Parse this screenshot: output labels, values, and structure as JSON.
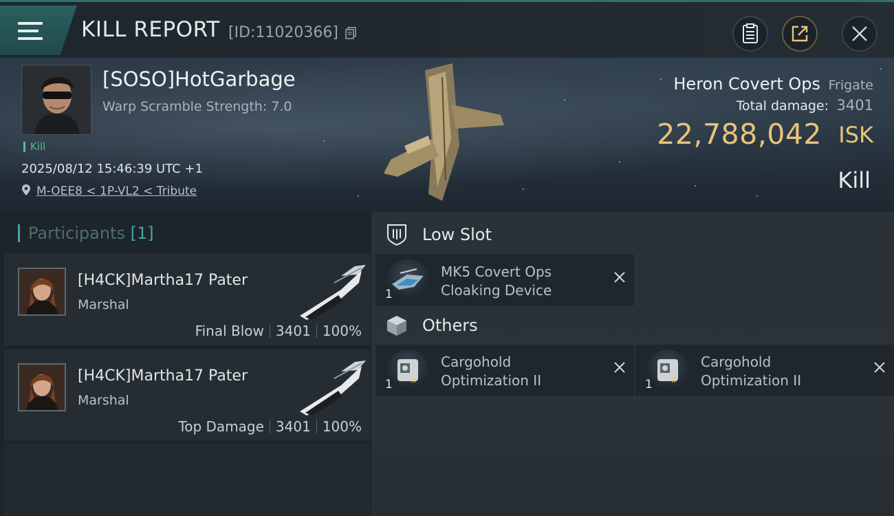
{
  "header": {
    "title": "KILL REPORT",
    "report_id": "[ID:11020366]"
  },
  "victim": {
    "name": "[SOSO]HotGarbage",
    "warp_scramble": "Warp Scramble Strength: 7.0",
    "kill_tag": "Kill",
    "timestamp": "2025/08/12 15:46:39 UTC +1",
    "location": "M-OEE8 < 1P-VL2 < Tribute",
    "ship_name": "Heron Covert Ops",
    "ship_class": "Frigate",
    "total_damage_label": "Total damage:",
    "total_damage": "3401",
    "isk_value": "22,788,042",
    "isk_unit": "ISK",
    "result": "Kill"
  },
  "participants": {
    "label": "Participants",
    "count": "[1]",
    "items": [
      {
        "name": "[H4CK]Martha17 Pater",
        "corp": "Marshal",
        "role": "Final Blow",
        "damage": "3401",
        "percent": "100%"
      },
      {
        "name": "[H4CK]Martha17 Pater",
        "corp": "Marshal",
        "role": "Top Damage",
        "damage": "3401",
        "percent": "100%"
      }
    ]
  },
  "fitting": {
    "low_slot": {
      "label": "Low Slot",
      "items": [
        {
          "line1": "MK5 Covert Ops",
          "line2": "Cloaking Device",
          "qty": "1"
        }
      ]
    },
    "others": {
      "label": "Others",
      "items": [
        {
          "line1": "Cargohold",
          "line2": "Optimization II",
          "qty": "1"
        },
        {
          "line1": "Cargohold",
          "line2": "Optimization II",
          "qty": "1"
        }
      ]
    }
  },
  "colors": {
    "accent_teal": "#3fa9a3",
    "isk_gold": "#e8c479",
    "kill_green": "#4fbf8f"
  }
}
